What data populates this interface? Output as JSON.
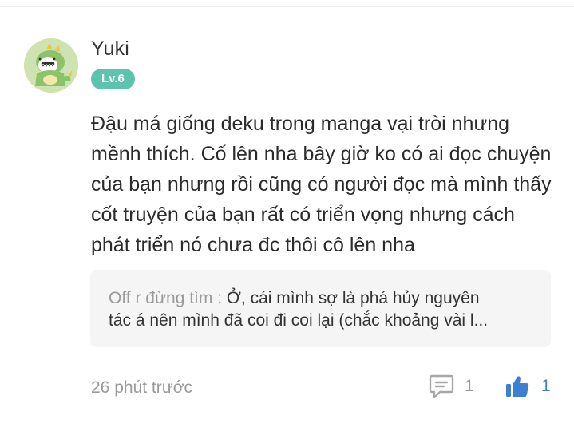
{
  "comment": {
    "author": "Yuki",
    "level": "Lv.6",
    "text": "Đậu má giống deku trong manga vại tròi nhưng mềnh thích. Cố lên nha bây giờ ko có ai đọc chuyện của bạn nhưng rồi cũng có người đọc mà mình thấy cốt truyện của bạn rất có triển vọng nhưng cách phát triển nó chưa đc thôi cô lên nha",
    "avatar_icon": "green-dinosaur-avatar",
    "level_badge_color": "#5cc4ad",
    "reply_preview": {
      "author": "Off r đừng tìm :",
      "line1": " Ở, cái mình sợ là phá hủy nguyên",
      "line2": "tác á nên mình đã coi đi coi lại (chắc khoảng vài l..."
    },
    "timestamp": "26 phút trước",
    "reply_count": "1",
    "like_count": "1",
    "reply_icon": "speech-bubble-icon",
    "like_icon": "thumbs-up-icon",
    "like_color": "#3d7fd0"
  }
}
